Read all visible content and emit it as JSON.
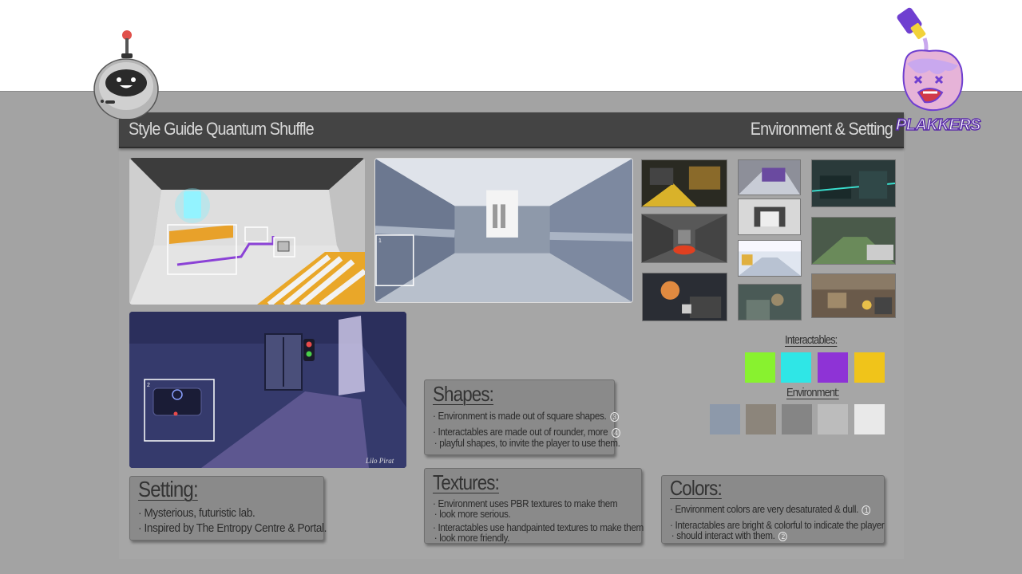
{
  "header": {
    "title": "Style Guide Quantum Shuffle",
    "section": "Environment & Setting"
  },
  "mascots": {
    "robot": "robot-mascot",
    "brand": "PLAKKERS"
  },
  "shapes": {
    "title": "Shapes:",
    "items": [
      {
        "text": "Environment is made out of square shapes.",
        "badge": "3"
      },
      {
        "text": "Interactables are made out of rounder, more",
        "badge": "4"
      },
      {
        "text": "playful shapes, to invite the player to use them.",
        "badge": ""
      }
    ]
  },
  "setting": {
    "title": "Setting:",
    "items": [
      "Mysterious, futuristic lab.",
      "Inspired by The Entropy Centre & Portal."
    ]
  },
  "textures": {
    "title": "Textures:",
    "items": [
      "Environment uses PBR textures to make them",
      "look more serious.",
      "Interactables use handpainted textures to make them",
      "look more friendly."
    ]
  },
  "colors": {
    "title": "Colors:",
    "items": [
      {
        "text": "Environment colors are very desaturated & dull.",
        "badge": "1"
      },
      {
        "text": "Interactables are bright & colorful to indicate the player",
        "badge": ""
      },
      {
        "text": "should interact with them.",
        "badge": "2"
      }
    ]
  },
  "palette": {
    "interactables_label": "Interactables:",
    "interactables": [
      "#88f22f",
      "#2fe6e6",
      "#8e33d6",
      "#f0c41a"
    ],
    "environment_label": "Environment:",
    "environment": [
      "#8d99aa",
      "#8c857b",
      "#858585",
      "#bcbcbc",
      "#e9e9e9"
    ]
  },
  "artwork": {
    "signature": "Lilo Pirat",
    "callout_1": "1",
    "callout_2": "2"
  }
}
